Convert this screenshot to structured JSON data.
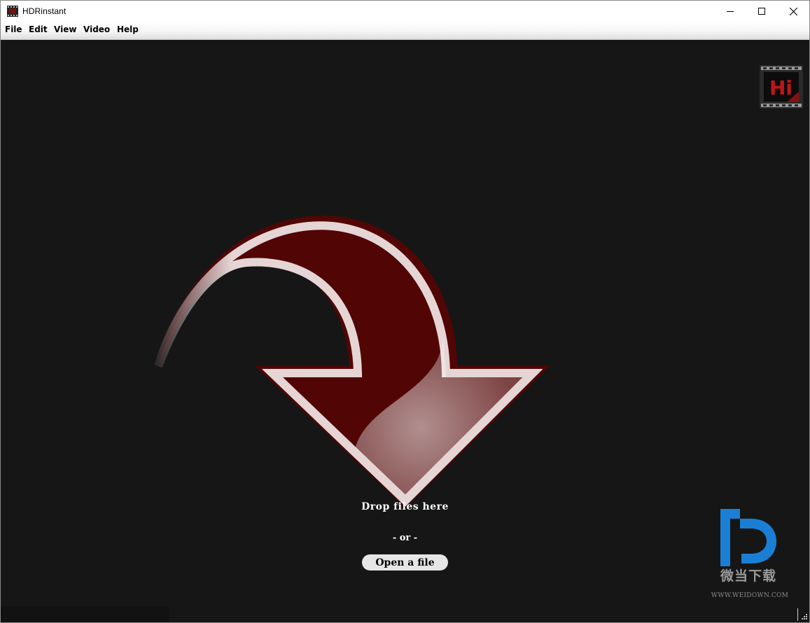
{
  "window": {
    "title": "HDRinstant"
  },
  "menu": {
    "file": "File",
    "edit": "Edit",
    "view": "View",
    "video": "Video",
    "help": "Help"
  },
  "drop_zone": {
    "drop_text": "Drop files here",
    "or_text": "- or -",
    "open_button_label": "Open a file"
  },
  "logo": {
    "text": "Hi"
  },
  "watermark": {
    "name": "微当下载",
    "url": "WWW.WEIDOWN.COM"
  },
  "colors": {
    "arrow_fill": "#520505",
    "arrow_stroke": "#e6d5d5",
    "canvas_bg": "#161616",
    "watermark_blue": "#1a7fd4"
  },
  "icons": [
    "app-icon",
    "minimize-icon",
    "maximize-icon",
    "close-icon",
    "drop-arrow-icon",
    "hi-logo",
    "weidown-logo",
    "resize-grip-icon"
  ]
}
